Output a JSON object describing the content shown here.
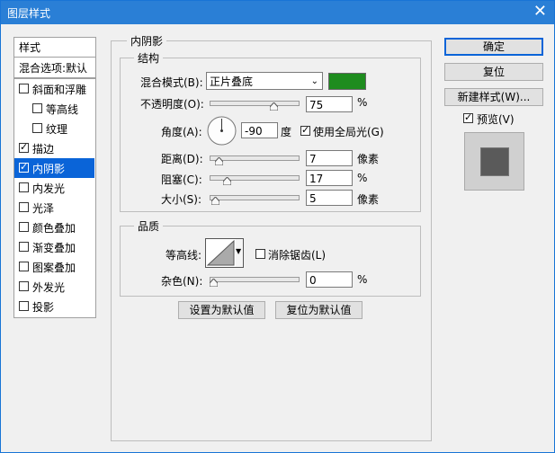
{
  "window": {
    "title": "图层样式",
    "close": "✕"
  },
  "sidebar": {
    "header": "样式",
    "blend_default": "混合选项:默认",
    "items": [
      {
        "label": "斜面和浮雕",
        "checked": false,
        "indent": false,
        "selected": false
      },
      {
        "label": "等高线",
        "checked": false,
        "indent": true,
        "selected": false
      },
      {
        "label": "纹理",
        "checked": false,
        "indent": true,
        "selected": false
      },
      {
        "label": "描边",
        "checked": true,
        "indent": false,
        "selected": false
      },
      {
        "label": "内阴影",
        "checked": true,
        "indent": false,
        "selected": true
      },
      {
        "label": "内发光",
        "checked": false,
        "indent": false,
        "selected": false
      },
      {
        "label": "光泽",
        "checked": false,
        "indent": false,
        "selected": false
      },
      {
        "label": "颜色叠加",
        "checked": false,
        "indent": false,
        "selected": false
      },
      {
        "label": "渐变叠加",
        "checked": false,
        "indent": false,
        "selected": false
      },
      {
        "label": "图案叠加",
        "checked": false,
        "indent": false,
        "selected": false
      },
      {
        "label": "外发光",
        "checked": false,
        "indent": false,
        "selected": false
      },
      {
        "label": "投影",
        "checked": false,
        "indent": false,
        "selected": false
      }
    ]
  },
  "inner_shadow": {
    "title": "内阴影",
    "structure": {
      "title": "结构",
      "blend_mode_label": "混合模式(B):",
      "blend_mode_value": "正片叠底",
      "shadow_color": "#1e8c1e",
      "opacity_label": "不透明度(O):",
      "opacity_value": "75",
      "opacity_level": 0.75,
      "percent": "%",
      "angle_label": "角度(A):",
      "angle_value": "-90",
      "angle_unit": "度",
      "global_light_label": "使用全局光(G)",
      "global_light_checked": true,
      "distance_label": "距离(D):",
      "distance_value": "7",
      "distance_level": 0.07,
      "px_unit": "像素",
      "choke_label": "阻塞(C):",
      "choke_value": "17",
      "choke_level": 0.17,
      "size_label": "大小(S):",
      "size_value": "5",
      "size_level": 0.02
    },
    "quality": {
      "title": "品质",
      "contour_label": "等高线:",
      "antialias_label": "消除锯齿(L)",
      "antialias_checked": false,
      "noise_label": "杂色(N):",
      "noise_value": "0",
      "noise_level": 0,
      "percent": "%"
    },
    "set_default": "设置为默认值",
    "reset_default": "复位为默认值"
  },
  "actions": {
    "ok": "确定",
    "reset": "复位",
    "new_style": "新建样式(W)...",
    "preview_label": "预览(V)",
    "preview_checked": true
  }
}
